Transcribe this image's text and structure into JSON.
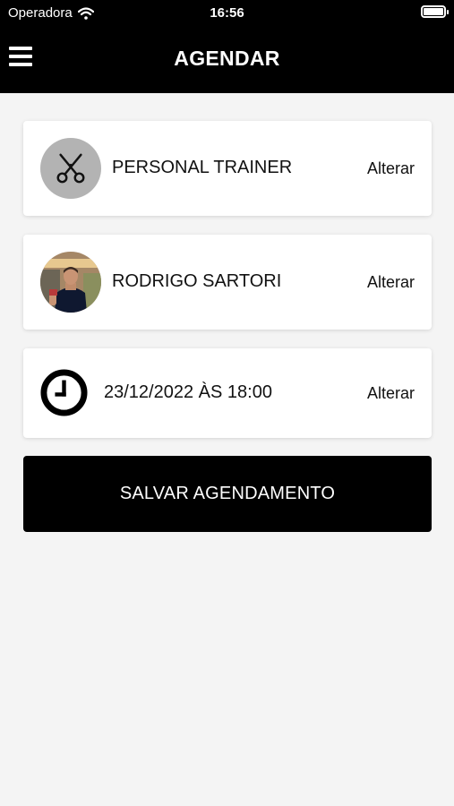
{
  "status_bar": {
    "carrier": "Operadora",
    "time": "16:56"
  },
  "header": {
    "title": "AGENDAR"
  },
  "service": {
    "label": "PERSONAL TRAINER",
    "action": "Alterar"
  },
  "professional": {
    "name": "RODRIGO SARTORI",
    "action": "Alterar"
  },
  "datetime": {
    "label": "23/12/2022 ÀS 18:00",
    "action": "Alterar"
  },
  "save_button": {
    "label": "SALVAR AGENDAMENTO"
  },
  "colors": {
    "header_bg": "#000000",
    "page_bg": "#f4f4f4",
    "card_bg": "#ffffff",
    "service_icon_bg": "#b3b3b3"
  },
  "icons": [
    "wifi-icon",
    "battery-icon",
    "menu-icon",
    "scissors-icon",
    "clock-icon"
  ]
}
